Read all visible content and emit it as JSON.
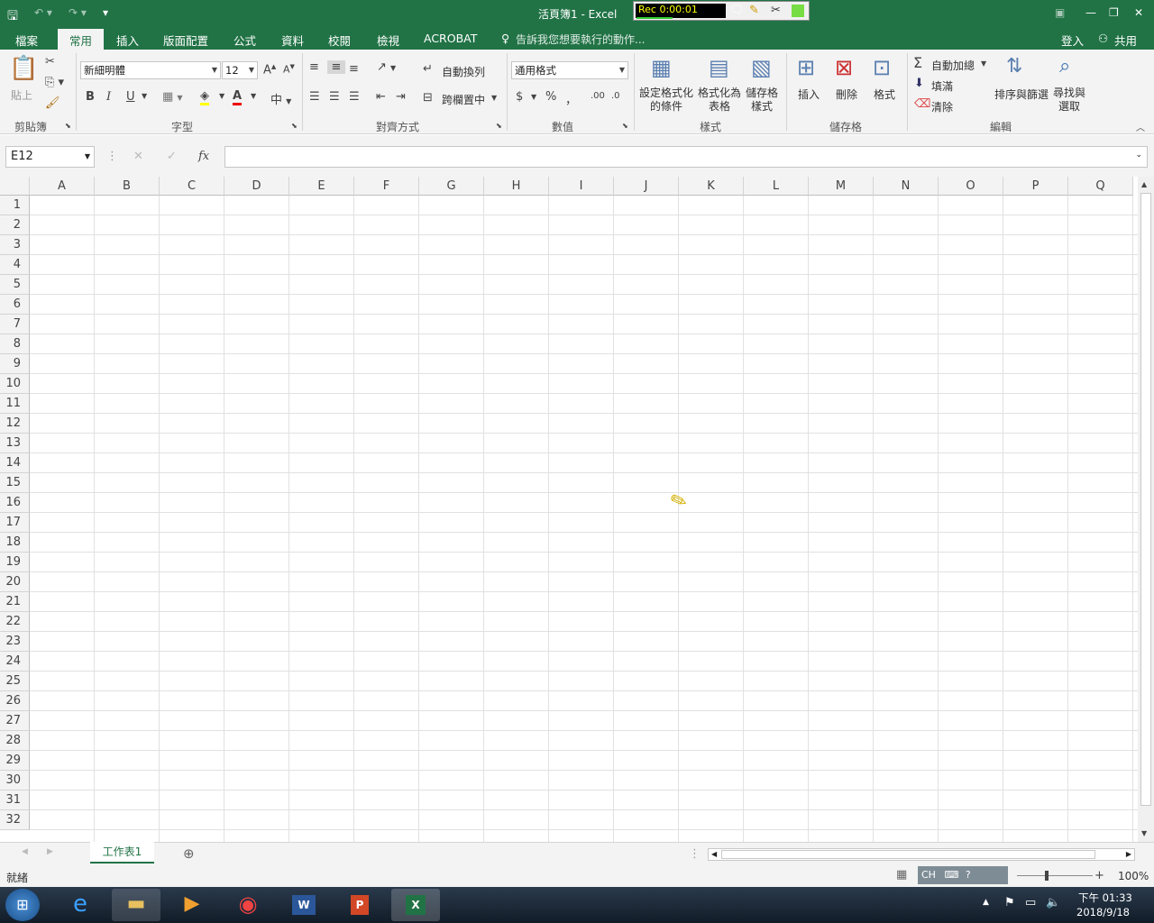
{
  "titlebar": {
    "title": "活頁簿1 - Excel",
    "rec_label": "Rec 0:00:01",
    "save_icon": "save-icon",
    "undo_icon": "undo-icon",
    "redo_icon": "redo-icon",
    "customize_icon": "customize-qat-icon"
  },
  "tabs": [
    {
      "label": "檔案"
    },
    {
      "label": "常用"
    },
    {
      "label": "插入"
    },
    {
      "label": "版面配置"
    },
    {
      "label": "公式"
    },
    {
      "label": "資料"
    },
    {
      "label": "校閱"
    },
    {
      "label": "檢視"
    },
    {
      "label": "ACROBAT"
    }
  ],
  "tell_me": "告訴我您想要執行的動作...",
  "account": {
    "signin": "登入",
    "share": "共用"
  },
  "ribbon": {
    "clipboard": {
      "paste": "貼上",
      "label": "剪貼簿"
    },
    "font": {
      "name": "新細明體",
      "size": "12",
      "bold": "B",
      "italic": "I",
      "underline": "U",
      "label": "字型"
    },
    "alignment": {
      "wrap": "自動換列",
      "merge": "跨欄置中",
      "label": "對齊方式"
    },
    "number": {
      "format": "通用格式",
      "currency": "$",
      "percent": "%",
      "comma": "，",
      "label": "數值"
    },
    "styles": {
      "conditional": "設定格式化的條件",
      "table": "格式化為表格",
      "cell": "儲存格樣式",
      "label": "樣式"
    },
    "cells": {
      "insert": "插入",
      "delete": "刪除",
      "format": "格式",
      "label": "儲存格"
    },
    "editing": {
      "autosum": "自動加總",
      "fill": "填滿",
      "clear": "清除",
      "sort": "排序與篩選",
      "find": "尋找與選取",
      "label": "編輯"
    }
  },
  "formula_bar": {
    "name_box": "E12",
    "fx": "fx"
  },
  "columns": [
    "A",
    "B",
    "C",
    "D",
    "E",
    "F",
    "G",
    "H",
    "I",
    "J",
    "K",
    "L",
    "M",
    "N",
    "O",
    "P",
    "Q"
  ],
  "rows": [
    "1",
    "2",
    "3",
    "4",
    "5",
    "6",
    "7",
    "8",
    "9",
    "10",
    "11",
    "12",
    "13",
    "14",
    "15",
    "16",
    "17",
    "18",
    "19",
    "20",
    "21",
    "22",
    "23",
    "24",
    "25",
    "26",
    "27",
    "28",
    "29",
    "30",
    "31",
    "32"
  ],
  "sheet_tab": "工作表1",
  "status": {
    "ready": "就緒",
    "ime": "CH",
    "zoom": "100%"
  },
  "taskbar": {
    "time": "下午 01:33",
    "date": "2018/9/18"
  },
  "colors": {
    "excel_green": "#217346"
  }
}
